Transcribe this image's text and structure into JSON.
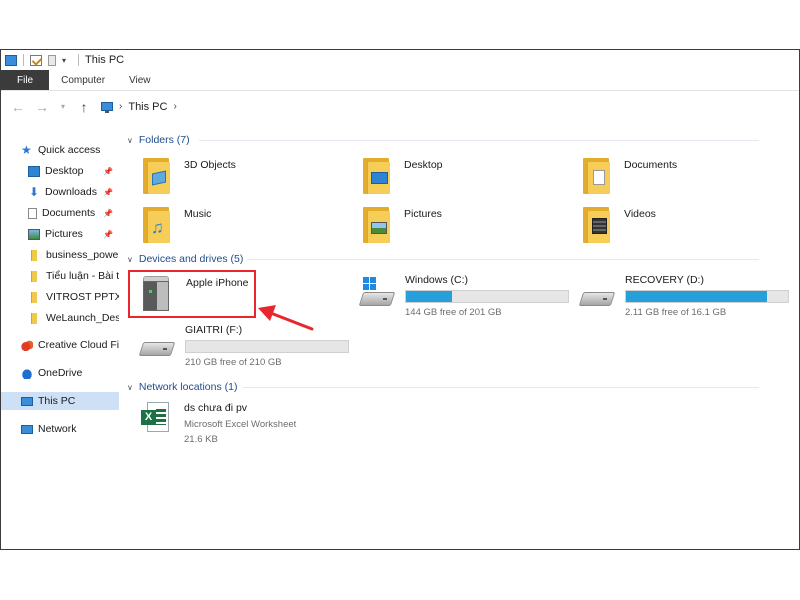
{
  "window": {
    "title": "This PC"
  },
  "ribbon": {
    "tabs": [
      "File",
      "Computer",
      "View"
    ]
  },
  "address": {
    "crumb": "This PC"
  },
  "sidebar": {
    "items": [
      {
        "label": "Quick access",
        "icon": "star-icon",
        "pinned": false
      },
      {
        "label": "Desktop",
        "icon": "desktop-icon",
        "pinned": true
      },
      {
        "label": "Downloads",
        "icon": "download-icon",
        "pinned": true
      },
      {
        "label": "Documents",
        "icon": "document-icon",
        "pinned": true
      },
      {
        "label": "Pictures",
        "icon": "pictures-icon",
        "pinned": true
      },
      {
        "label": "business_power",
        "icon": "folder-icon",
        "pinned": false
      },
      {
        "label": "Tiểu luận - Bài th",
        "icon": "folder-icon",
        "pinned": false
      },
      {
        "label": "VITROST PPTX",
        "icon": "folder-icon",
        "pinned": false
      },
      {
        "label": "WeLaunch_Desig",
        "icon": "folder-icon",
        "pinned": false
      },
      {
        "label": "Creative Cloud File",
        "icon": "creative-cloud-icon",
        "pinned": false
      },
      {
        "label": "OneDrive",
        "icon": "onedrive-icon",
        "pinned": false
      },
      {
        "label": "This PC",
        "icon": "this-pc-icon",
        "pinned": false,
        "selected": true
      },
      {
        "label": "Network",
        "icon": "network-icon",
        "pinned": false
      }
    ]
  },
  "folders": {
    "header": "Folders (7)",
    "items": [
      {
        "label": "3D Objects",
        "icon": "3d-objects-folder-icon"
      },
      {
        "label": "Desktop",
        "icon": "desktop-folder-icon"
      },
      {
        "label": "Documents",
        "icon": "documents-folder-icon"
      },
      {
        "label": "Music",
        "icon": "music-folder-icon"
      },
      {
        "label": "Pictures",
        "icon": "pictures-folder-icon"
      },
      {
        "label": "Videos",
        "icon": "videos-folder-icon"
      }
    ]
  },
  "devices": {
    "header": "Devices and drives (5)",
    "iphone": {
      "label": "Apple iPhone"
    },
    "drives": [
      {
        "label": "Windows (C:)",
        "free": "144 GB free of 201 GB",
        "used_fraction": 0.284
      },
      {
        "label": "RECOVERY (D:)",
        "free": "2.11 GB free of 16.1 GB",
        "used_fraction": 0.869
      },
      {
        "label": "GIAITRI (F:)",
        "free": "210 GB free of 210 GB",
        "used_fraction": 0.0
      }
    ]
  },
  "network": {
    "header": "Network locations (1)",
    "items": [
      {
        "name": "ds chưa đi pv",
        "type": "Microsoft Excel Worksheet",
        "size": "21.6 KB"
      }
    ]
  },
  "colors": {
    "bar_fill": "#26a0da",
    "highlight": "#e8262b",
    "section_header": "#1e4e8c",
    "selected_nav": "#cde0f5"
  }
}
